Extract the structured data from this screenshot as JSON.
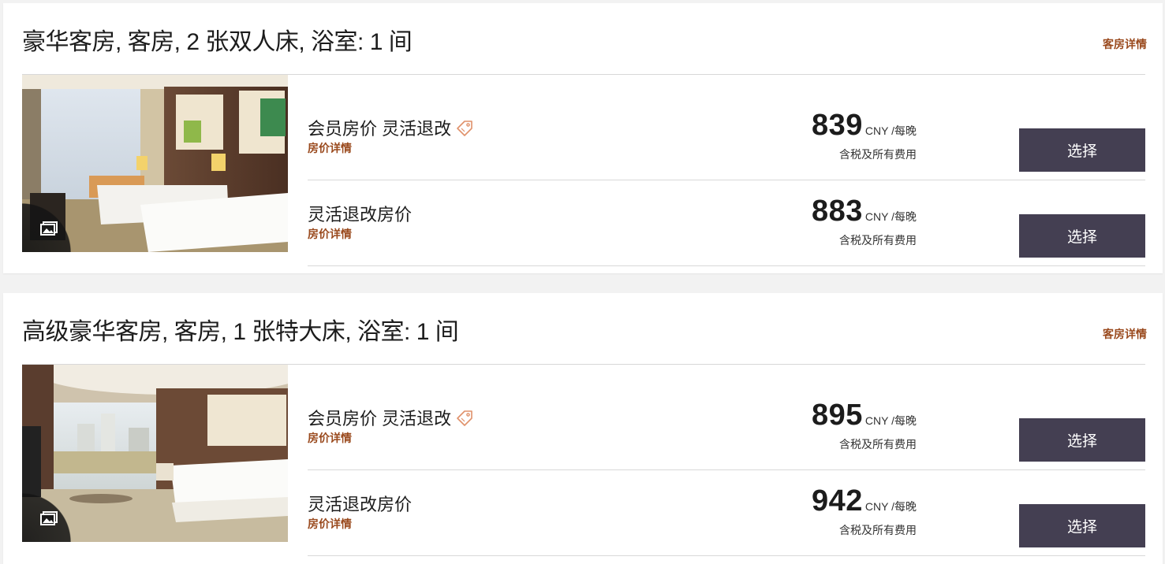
{
  "rooms": [
    {
      "title": "豪华客房, 客房, 2 张双人床, 浴室: 1 间",
      "details_link": "客房详情",
      "photo_icon": "gallery-icon",
      "rates": [
        {
          "name": "会员房价 灵活退改",
          "has_tag_icon": true,
          "details_link": "房价详情",
          "price": "839",
          "unit": "CNY /每晚",
          "note": "含税及所有费用",
          "button": "选择"
        },
        {
          "name": "灵活退改房价",
          "has_tag_icon": false,
          "details_link": "房价详情",
          "price": "883",
          "unit": "CNY /每晚",
          "note": "含税及所有费用",
          "button": "选择"
        }
      ]
    },
    {
      "title": "高级豪华客房, 客房, 1 张特大床, 浴室: 1 间",
      "details_link": "客房详情",
      "photo_icon": "gallery-icon",
      "rates": [
        {
          "name": "会员房价 灵活退改",
          "has_tag_icon": true,
          "details_link": "房价详情",
          "price": "895",
          "unit": "CNY /每晚",
          "note": "含税及所有费用",
          "button": "选择"
        },
        {
          "name": "灵活退改房价",
          "has_tag_icon": false,
          "details_link": "房价详情",
          "price": "942",
          "unit": "CNY /每晚",
          "note": "含税及所有费用",
          "button": "选择"
        }
      ]
    }
  ],
  "colors": {
    "accent_link": "#9a4a1e",
    "button_bg": "#443f52",
    "tag_icon": "#e0916a"
  }
}
